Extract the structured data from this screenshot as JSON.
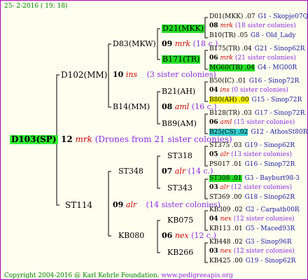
{
  "header": {
    "date": "25-  2-2016 ( 19: 18)"
  },
  "footer": {
    "copyright": "Copyright 2004-2016 @ Karl Kehrle Foundation.",
    "site": "www.pedigreeapis.org"
  },
  "colors": {
    "border": "#b000b0",
    "background": "#fffff0",
    "highlight_green": "#22dd22",
    "highlight_yellow": "#ffff00",
    "highlight_cyan": "#33cccc"
  },
  "root": {
    "id": "D103(SP)"
  },
  "gen1": {
    "sire": "D102(MM)",
    "num": "12",
    "code": "mrk",
    "note": "(Drones from 21 sister colonies)",
    "dam": "ST114"
  },
  "gen2": {
    "a": {
      "sire": "D83(MKW)",
      "num": "10",
      "code": "ins",
      "note": "(3 sister colonies)",
      "dam": "B14(MM)"
    },
    "b": {
      "sire": "ST348",
      "num": "09",
      "code": "alr",
      "note": "(14 sister colonies)",
      "dam": "KB080"
    }
  },
  "gen3": {
    "a": {
      "sire": "D21(MKK)",
      "num": "09",
      "code": "mrk",
      "note": "(18 c.)",
      "dam": "B171(TR)"
    },
    "b": {
      "sire": "B21(AH)",
      "num": "08",
      "code": "aml",
      "note": "(16 c.)",
      "dam": "B89(AM)"
    },
    "c": {
      "sire": "ST318",
      "num": "07",
      "code": "alr",
      "note": "(14 c.)",
      "dam": "ST343"
    },
    "d": {
      "sire": "KB075",
      "num": "06",
      "code": "nex",
      "note": "(12 c.)",
      "dam": "KB266"
    }
  },
  "gen4": [
    {
      "sire": "D01(MKK) .07",
      "sire_loc": "G1 - Skopje07Q",
      "num": "08",
      "code": "mrk",
      "note": "(18 sister colonies)",
      "dam": "B10(TR) .05",
      "dam_loc": "G8 - Old_Lady"
    },
    {
      "sire": "B175(TR) .04",
      "sire_loc": "G21 - Sinop62R",
      "num": "06",
      "code": "mrk",
      "note": "(21 sister colonies)",
      "dam": "MG60(TR) .04",
      "dam_loc": "G4 - MG00R"
    },
    {
      "sire": "B50(IC) .01",
      "sire_loc": "G16 - Sinop72R",
      "num": "04",
      "code": "ins",
      "note": "(0 sister colonies)",
      "dam": "B80(AH) .00",
      "dam_loc": "G15 - Sinop72R"
    },
    {
      "sire": "B128(TR) .03",
      "sire_loc": "G17 - Sinop72R",
      "num": "06",
      "code": "aml",
      "note": "(15 sister colonies)",
      "dam": "B25(CS) .02",
      "dam_loc": "G12 - AthosSt80R"
    },
    {
      "sire": "ST375 .03",
      "sire_loc": "G19 - Sinop62R",
      "num": "05",
      "code": "alr",
      "note": "(13 sister colonies)",
      "dam": "PS017 .01",
      "dam_loc": "G16 - Sinop72R"
    },
    {
      "sire": "ST308 .01",
      "sire_loc": "G3 - Bayburt98-3",
      "num": "03",
      "code": "alr",
      "note": "(12 sister colonies)",
      "dam": "ST369 .00",
      "dam_loc": "G18 - Sinop62R"
    },
    {
      "sire": "KB309 .02",
      "sire_loc": "G2 - Carpath00R",
      "num": "04",
      "code": "nex",
      "note": "(12 sister colonies)",
      "dam": "KB113 .01",
      "dam_loc": "G5 - Maced93R"
    },
    {
      "sire": "KB448 .02",
      "sire_loc": "G3 - Sinop96R",
      "num": "03",
      "code": "nex",
      "note": "(12 sister colonies)",
      "dam": "KB425 .00",
      "dam_loc": "G19 - Sinop62R"
    }
  ]
}
